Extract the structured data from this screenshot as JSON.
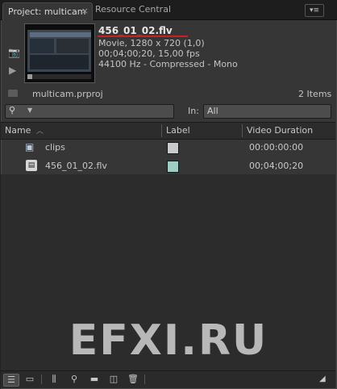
{
  "tabs": {
    "active": "Project: multicam",
    "close": "×",
    "inactive": "Resource Central",
    "menu": "▾≡"
  },
  "preview": {
    "clip_name": "456_01_02.flv",
    "info": [
      "Movie, 1280 x 720 (1,0)",
      "00;04;00;20, 15,00 fps",
      "44100 Hz - Compressed - Mono"
    ]
  },
  "project": {
    "file_name": "multicam.prproj",
    "items_count": "2 Items"
  },
  "filter": {
    "in_label": "In:",
    "in_value": "All"
  },
  "table": {
    "columns": [
      "Name",
      "Label",
      "Video Duration"
    ],
    "rows": [
      {
        "name": "clips",
        "label_color": "#c8cbcb",
        "duration": "00:00:00:00",
        "icon": "bin-icon"
      },
      {
        "name": "456_01_02.flv",
        "label_color": "#a0ccc6",
        "duration": "00;04;00;20",
        "icon": "film-icon"
      }
    ]
  },
  "watermark": "EFXI.RU",
  "colors": {
    "accent_underline": "#cc1f1f",
    "panel_bg": "#363636"
  }
}
